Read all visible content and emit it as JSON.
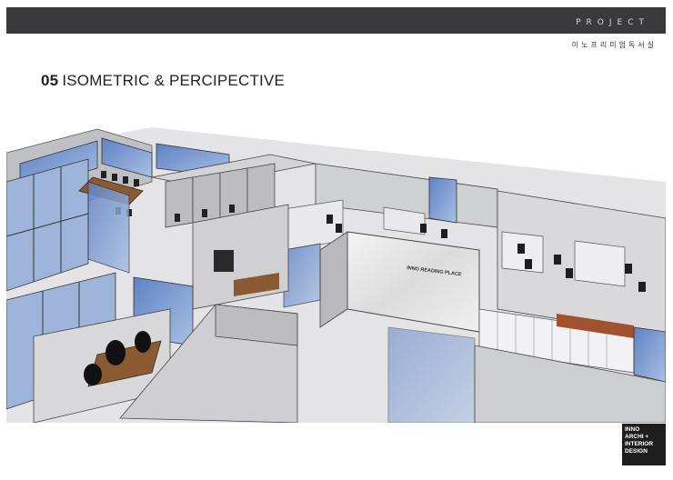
{
  "header": {
    "project_label": "PROJECT",
    "project_name": "이노프리미엄독서실"
  },
  "title": {
    "number": "05",
    "text": "ISOMETRIC & PERCIPECTIVE"
  },
  "render": {
    "room_sign": "INNO READING PLACE"
  },
  "logo": {
    "line1": "INNO",
    "line2": "ARCHI +",
    "line3": "INTERIOR",
    "line4": "DESIGN"
  },
  "colors": {
    "bar": "#3a3a3c",
    "glass": "#7f9fd2",
    "wall": "#c9c9cc",
    "floor": "#e6e6e8"
  }
}
